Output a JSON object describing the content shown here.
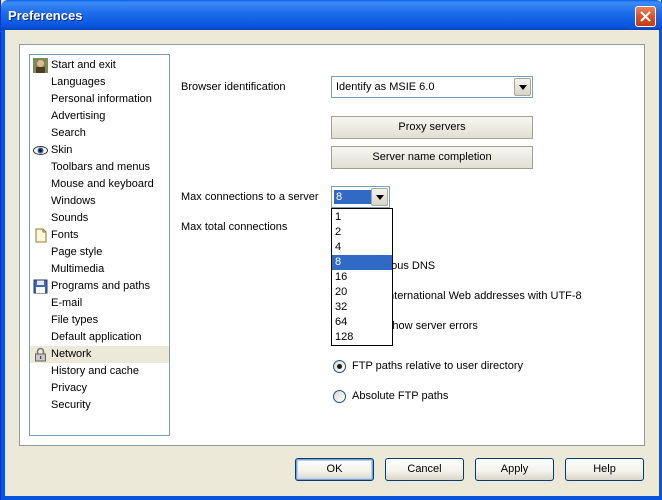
{
  "window": {
    "title": "Preferences"
  },
  "sidebar": {
    "items": [
      {
        "label": "Start and exit",
        "icon": "user-avatar-icon"
      },
      {
        "label": "Languages"
      },
      {
        "label": "Personal information"
      },
      {
        "label": "Advertising"
      },
      {
        "label": "Search"
      },
      {
        "label": "Skin",
        "icon": "eye-icon"
      },
      {
        "label": "Toolbars and menus"
      },
      {
        "label": "Mouse and keyboard"
      },
      {
        "label": "Windows"
      },
      {
        "label": "Sounds"
      },
      {
        "label": "Fonts",
        "icon": "document-icon"
      },
      {
        "label": "Page style"
      },
      {
        "label": "Multimedia"
      },
      {
        "label": "Programs and paths",
        "icon": "floppy-disk-icon"
      },
      {
        "label": "E-mail"
      },
      {
        "label": "File types"
      },
      {
        "label": "Default application"
      },
      {
        "label": "Network",
        "icon": "lock-icon",
        "selected": true
      },
      {
        "label": "History and cache"
      },
      {
        "label": "Privacy"
      },
      {
        "label": "Security"
      }
    ]
  },
  "network": {
    "browser_id_label": "Browser identification",
    "browser_id_value": "Identify as MSIE 6.0",
    "proxy_button": "Proxy servers",
    "server_name_button": "Server name completion",
    "max_conn_server_label": "Max connections to a server",
    "max_conn_server_value": "8",
    "max_total_conn_label": "Max total connections",
    "dropdown_options": [
      "1",
      "2",
      "4",
      "8",
      "16",
      "20",
      "32",
      "64",
      "128"
    ],
    "dropdown_selected_index": 3,
    "async_dns_partial": "hous DNS",
    "utf8_partial": "International Web addresses with UTF-8",
    "server_errors_partial": "Show server errors",
    "ftp_relative_label": "FTP paths relative to user directory",
    "ftp_absolute_label": "Absolute FTP paths",
    "ftp_selected": "relative"
  },
  "footer": {
    "ok": "OK",
    "cancel": "Cancel",
    "apply": "Apply",
    "help": "Help"
  },
  "colors": {
    "titlebar": "#0855DD",
    "selection": "#316AC5",
    "dialog_bg": "#ECE9D8"
  }
}
